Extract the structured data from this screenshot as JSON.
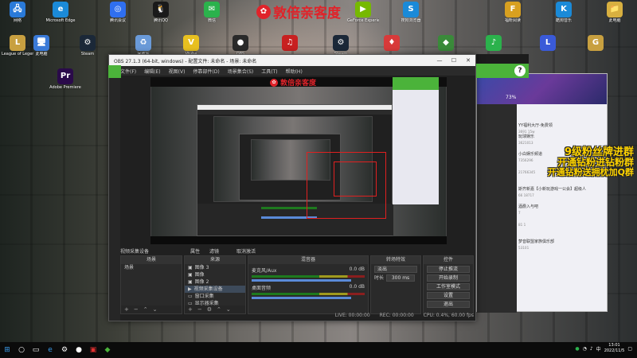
{
  "watermark": {
    "text": "敦倍亲客度",
    "logo": "✿"
  },
  "desktop_icons": [
    {
      "label": "网络",
      "icon": "network-icon",
      "color": "#2a7ad8",
      "glyph": "🖧"
    },
    {
      "label": "Microsoft Edge",
      "icon": "edge-icon",
      "color": "#1b8ad8",
      "glyph": "e"
    },
    {
      "label": "腾讯会议",
      "icon": "meeting-icon",
      "color": "#2f6ff0",
      "glyph": "◎"
    },
    {
      "label": "腾讯QQ",
      "icon": "qq-icon",
      "color": "#1a1a1a",
      "glyph": "🐧"
    },
    {
      "label": "微信",
      "icon": "wechat-icon",
      "color": "#2bb24c",
      "glyph": "✉"
    },
    {
      "label": "GeForce Experience",
      "icon": "nvidia-icon",
      "color": "#76b900",
      "glyph": "▶"
    },
    {
      "label": "搜狗浏览器",
      "icon": "sogou-icon",
      "color": "#1a8ad8",
      "glyph": "S"
    },
    {
      "label": "福昕阅读",
      "icon": "reader-icon",
      "color": "#d8a020",
      "glyph": "F"
    },
    {
      "label": "酷狗音乐",
      "icon": "kugou-icon",
      "color": "#1a8ad8",
      "glyph": "K"
    },
    {
      "label": "此电脑",
      "icon": "admin-icon",
      "color": "#d8b040",
      "glyph": "📁"
    },
    {
      "label": "League of Legends",
      "icon": "lol-icon",
      "color": "#c8a040",
      "glyph": "L"
    },
    {
      "label": "此电脑",
      "icon": "pc-icon",
      "color": "#3a7ad8",
      "glyph": "🖥"
    },
    {
      "label": "Steam",
      "icon": "steam-icon",
      "color": "#1b2838",
      "glyph": "⚙"
    },
    {
      "label": "回收站",
      "icon": "recycle-icon",
      "color": "#6a9ad8",
      "glyph": "♻"
    },
    {
      "label": "Vtube",
      "icon": "vtube-icon",
      "color": "#e8c020",
      "glyph": "V"
    },
    {
      "label": "OBS",
      "icon": "obs-app-icon",
      "color": "#2a2a2a",
      "glyph": "●"
    },
    {
      "label": "",
      "icon": "netease-icon",
      "color": "#c82020",
      "glyph": "♫"
    },
    {
      "label": "Steam",
      "icon": "steam2-icon",
      "color": "#1b2838",
      "glyph": "⚙"
    },
    {
      "label": "",
      "icon": "game-icon",
      "color": "#d83a3a",
      "glyph": "♦"
    },
    {
      "label": "",
      "icon": "app-icon",
      "color": "#3a8a3a",
      "glyph": "◆"
    },
    {
      "label": "",
      "icon": "qq-music-icon",
      "color": "#2bb24c",
      "glyph": "♪"
    },
    {
      "label": "",
      "icon": "lol2-icon",
      "color": "#3a5ad8",
      "glyph": "L"
    },
    {
      "label": "",
      "icon": "game2-icon",
      "color": "#c8a040",
      "glyph": "G"
    },
    {
      "label": "Adobe Premiere",
      "icon": "premiere-icon",
      "color": "#2a0a4a",
      "glyph": "Pr"
    }
  ],
  "obs": {
    "title": "OBS 27.1.3 (64-bit, windows) - 配置文件: 未命名 - 场景: 未命名",
    "menu": [
      "文件(F)",
      "编辑(E)",
      "视图(V)",
      "停靠部件(D)",
      "场景集合(S)",
      "工具(T)",
      "帮助(H)"
    ],
    "toolbar": {
      "source_label": "视频采集设备",
      "properties": "属性",
      "filters": "滤镜",
      "deactivate": "取消激活"
    },
    "docks": {
      "scenes": {
        "title": "场景",
        "items": [
          "场景"
        ]
      },
      "sources": {
        "title": "来源",
        "items": [
          "图像 3",
          "图像",
          "图像 2",
          "视频采集设备",
          "窗口采集",
          "显示器采集"
        ]
      },
      "mixer": {
        "title": "混音器",
        "tracks": [
          {
            "name": "麦克风/Aux",
            "level": "0.0 dB"
          },
          {
            "name": "桌面音频",
            "level": "0.0 dB"
          }
        ]
      },
      "transitions": {
        "title": "转场特效",
        "type": "淡出",
        "duration_label": "时长",
        "duration": "300 ms"
      },
      "controls": {
        "title": "控件",
        "buttons": [
          "停止推流",
          "开始录制",
          "工作室模式",
          "设置",
          "退出"
        ]
      }
    },
    "status": {
      "live": "LIVE: 00:00:00",
      "rec": "REC: 00:00:00",
      "cpu": "CPU: 0.4%, 60.00 fps"
    }
  },
  "chat": {
    "items": [
      {
        "name": "YY福利大厅-免费领",
        "sub": "3691 15w"
      },
      {
        "name": "玩球娱乐",
        "sub": "3621013"
      },
      {
        "name": "小白娱乐频道",
        "sub": "7356296"
      },
      {
        "name": "",
        "sub": "21766345"
      },
      {
        "name": "斯齐新嘉【小新玩游戏一公会】超级人",
        "sub": "66  18717"
      },
      {
        "name": "酒爵入与吧",
        "sub": "7"
      },
      {
        "name": "",
        "sub": "81  1"
      },
      {
        "name": "梦音联盟家族俱乐部",
        "sub": "53101"
      }
    ],
    "banners": [
      "9级粉丝牌进群",
      "开通钻粉进钻粉群",
      "开通钻粉送拥枕加Q群"
    ],
    "percent": "73%"
  },
  "taskbar": {
    "time": "13:01",
    "date": "2022/11/5"
  }
}
